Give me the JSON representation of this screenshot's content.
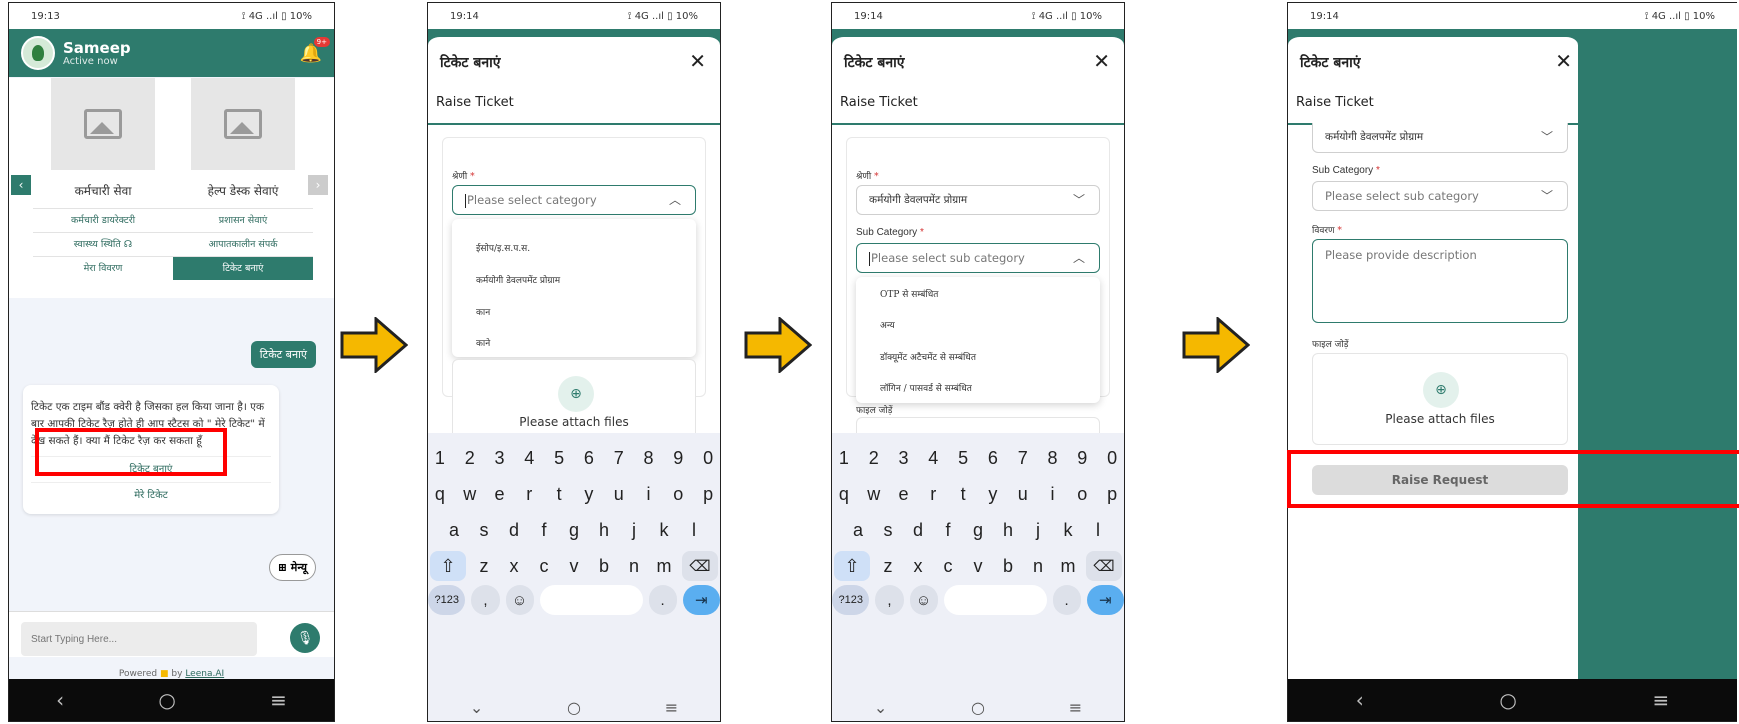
{
  "status": {
    "p1": "19:13",
    "p2": "19:14",
    "p3": "19:14",
    "p4": "19:14",
    "icons": "⟟ 4G ..ıl ▯ 10%"
  },
  "chat": {
    "bot_name": "Sameep",
    "bot_status": "Active now",
    "notification_count": "9+",
    "cards": [
      {
        "title": "कर्मचारी सेवा",
        "links": [
          "कर्मचारी डायरेक्टरी",
          "स्वास्थ्य स्थिति ☊",
          "मेरा विवरण"
        ]
      },
      {
        "title": "हेल्प डेस्क सेवाएं",
        "links": [
          "प्रशासन सेवाएं",
          "आपातकालीन संपर्क",
          "टिकेट बनाएं"
        ]
      }
    ],
    "user_chip": "टिकेट बनाएं",
    "bot_message": "टिकेट एक टाइम बौंड क्वेरी है जिसका हल किया जाना है। एक बार आपकी टिकेट रैज़ होते ही आप स्टैटस को \" मेरे टिकेट\" में देख सकते हैं। क्या मैं टिकेट रैज़ कर सकता हूँ",
    "bot_buttons": [
      "टिकेट बनाएं",
      "मेरे टिकेट"
    ],
    "menu_label": "मेन्यू",
    "input_placeholder": "Start Typing Here...",
    "powered_prefix": "Powered",
    "powered_by": "by",
    "powered_brand": "Leena.AI"
  },
  "form": {
    "title": "टिकेट बनाएं",
    "subtitle": "Raise Ticket",
    "category_label": "श्रेणी",
    "category_placeholder": "Please select category",
    "category_value": "कर्मयोगी डेवलपमेंट प्रोग्राम",
    "category_options": [
      "ईसोप/इ.स.प.स.",
      "कर्मयोगी डेवलपमेंट प्रोग्राम",
      "कान",
      "काने"
    ],
    "subcategory_label": "Sub Category",
    "subcategory_placeholder": "Please select sub category",
    "subcategory_options": [
      "OTP से सम्बंधित",
      "अन्य",
      "डॉक्यूमेंट अटैचमेंट से सम्बंधित",
      "लॉगिन / पासवर्ड से सम्बंधित"
    ],
    "description_label": "विवरण",
    "description_placeholder": "Please provide description",
    "attach_label": "फाइल जोड़ें",
    "attach_text": "Please attach files",
    "submit_label": "Raise Request",
    "required_mark": "*"
  },
  "keyboard": {
    "row_numbers": [
      "1",
      "2",
      "3",
      "4",
      "5",
      "6",
      "7",
      "8",
      "9",
      "0"
    ],
    "row1": [
      "q",
      "w",
      "e",
      "r",
      "t",
      "y",
      "u",
      "i",
      "o",
      "p"
    ],
    "row2": [
      "a",
      "s",
      "d",
      "f",
      "g",
      "h",
      "j",
      "k",
      "l"
    ],
    "row3": [
      "z",
      "x",
      "c",
      "v",
      "b",
      "n",
      "m"
    ],
    "sym_label": "?123",
    "comma": ",",
    "period": "."
  },
  "colors": {
    "brand": "#2e7b6d",
    "highlight": "#ff0000",
    "arrow": "#f5b800"
  }
}
